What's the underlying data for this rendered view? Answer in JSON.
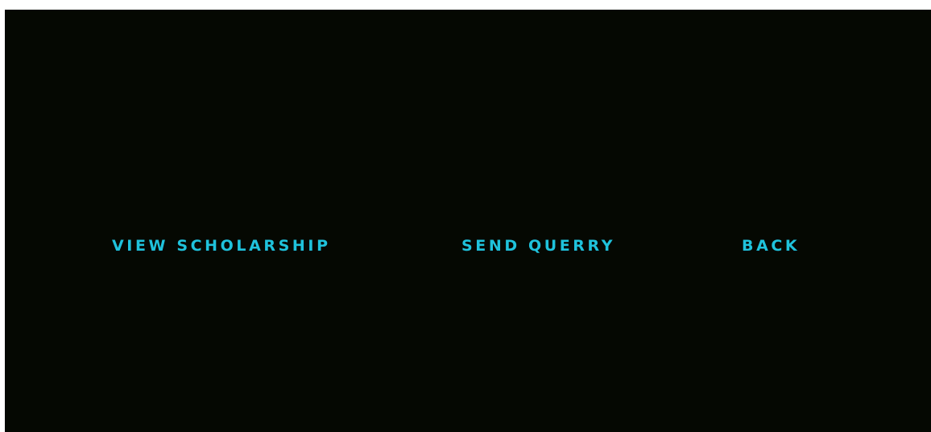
{
  "menu": {
    "items": [
      {
        "label": "VIEW SCHOLARSHIP"
      },
      {
        "label": "SEND QUERRY"
      },
      {
        "label": "BACK"
      }
    ]
  },
  "colors": {
    "background": "#050802",
    "page": "#ffffff",
    "link": "#1fc2dc"
  }
}
